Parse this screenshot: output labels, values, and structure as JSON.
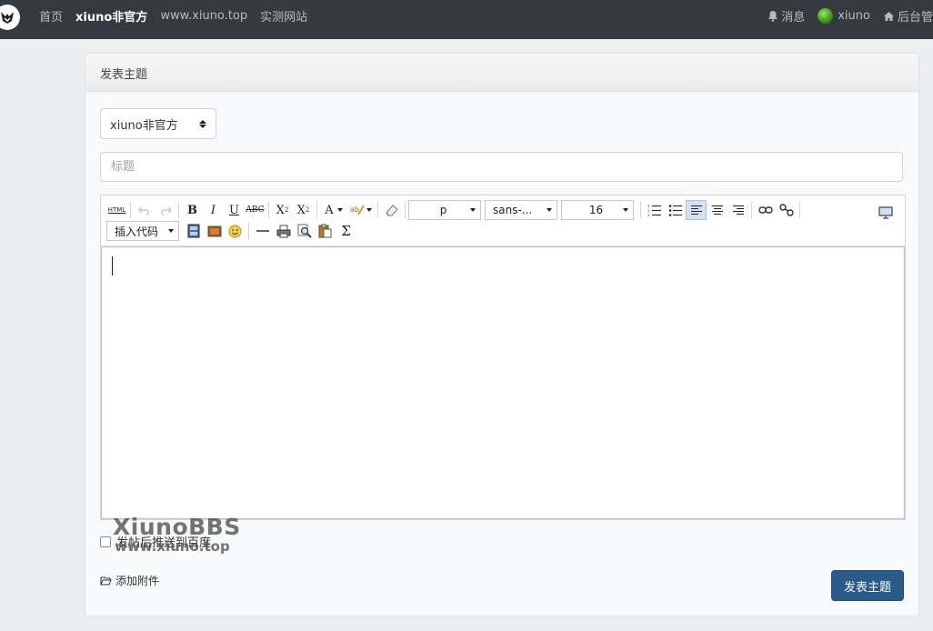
{
  "nav": {
    "links": [
      {
        "label": "首页",
        "active": false
      },
      {
        "label": "xiuno非官方",
        "active": true
      },
      {
        "label": "www.xiuno.top",
        "active": false
      },
      {
        "label": "实测网站",
        "active": false
      }
    ],
    "messages_label": "消息",
    "username": "xiuno",
    "admin_label": "后台管"
  },
  "card": {
    "header_title": "发表主题",
    "forum_select": {
      "selected": "xiuno非官方"
    },
    "title_input": {
      "value": "",
      "placeholder": "标题"
    },
    "toolbar": {
      "html_label": "HTML",
      "paragraph_select": "p",
      "font_select": "sans-...",
      "size_select": "16",
      "insert_code_select": "插入代码",
      "buttons": [
        "html-source",
        "undo",
        "redo",
        "bold",
        "italic",
        "underline",
        "strikethrough",
        "superscript",
        "subscript",
        "font-color",
        "highlight",
        "clear-format",
        "ordered-list",
        "unordered-list",
        "align-left",
        "align-center",
        "align-right",
        "link",
        "unlink",
        "fullscreen",
        "insert-video",
        "insert-image",
        "emoticon",
        "horizontal-rule",
        "print",
        "preview",
        "paste",
        "formula"
      ]
    },
    "push_baidu_label": "发帖后推送到百度",
    "push_baidu_checked": false,
    "attach_label": "添加附件",
    "submit_label": "发表主题",
    "watermark": {
      "line1": "XiunoBBS",
      "line2": "www.xiuno.top"
    }
  },
  "colors": {
    "navbar": "#343a40",
    "submit": "#2a5a8a",
    "background": "#ebedef"
  }
}
